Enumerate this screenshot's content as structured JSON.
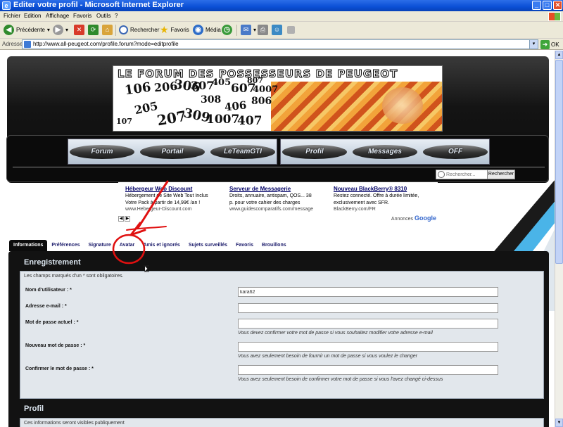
{
  "window": {
    "title": "Editer votre profil - Microsoft Internet Explorer",
    "minimize": "_",
    "maximize": "□",
    "close": "✕"
  },
  "menu": [
    "Fichier",
    "Edition",
    "Affichage",
    "Favoris",
    "Outils",
    "?"
  ],
  "toolbar": {
    "back": "Précédente",
    "search": "Rechercher",
    "favorites": "Favoris",
    "media": "Média"
  },
  "address": {
    "label": "Adresse",
    "url": "http://www.all-peugeot.com/profile.forum?mode=editprofile",
    "go": "OK"
  },
  "banner": {
    "title": "LE FORUM DES POSSESSEURS DE PEUGEOT",
    "numbers": [
      "106",
      "206",
      "306",
      "307",
      "405",
      "607",
      "4007",
      "807",
      "205",
      "308",
      "406",
      "806",
      "1007",
      "407",
      "207",
      "309",
      "107"
    ]
  },
  "nav": {
    "left": [
      "Forum",
      "Portail",
      "LeTeamGTI"
    ],
    "right": [
      "Profil",
      "Messages",
      "OFF"
    ],
    "search_placeholder": "Rechercher...",
    "search_button": "Rechercher"
  },
  "ads": [
    {
      "title": "Hébergeur Web Discount",
      "lines": [
        "Hébergement de Site Web Tout Inclus",
        "Votre Pack à partir de 14,99€ /an !"
      ],
      "url": "www.Hebergeur-Discount.com"
    },
    {
      "title": "Serveur de Messagerie",
      "lines": [
        "Droits, annuaire, antispam, QOS... 38",
        "p. pour votre cahier des charges"
      ],
      "url": "www.guidescomparatifs.com/message"
    },
    {
      "title": "Nouveau BlackBerry® 8310",
      "lines": [
        "Restez connecté. Offre à durée limitée,",
        "exclusivement avec SFR."
      ],
      "url": "BlackBerry.com/FR"
    }
  ],
  "ads_label": "Annonces",
  "ads_brand": "Google",
  "tabs": [
    "Informations",
    "Préférences",
    "Signature",
    "Avatar",
    "Amis et ignorés",
    "Sujets surveillés",
    "Favoris",
    "Brouillons"
  ],
  "form": {
    "section1": "Enregistrement",
    "required_note": "Les champs marqués d'un * sont obligatoires.",
    "fields": [
      {
        "label": "Nom d'utilisateur : *",
        "value": "kara62",
        "help": ""
      },
      {
        "label": "Adresse e-mail : *",
        "value": "",
        "help": ""
      },
      {
        "label": "Mot de passe actuel : *",
        "value": "",
        "help": "Vous devez confirmer votre mot de passe si vous souhaitez modifier votre adresse e-mail"
      },
      {
        "label": "Nouveau mot de passe : *",
        "value": "",
        "help": "Vous avez seulement besoin de fournir un mot de passe si vous voulez le changer"
      },
      {
        "label": "Confirmer le mot de passe : *",
        "value": "",
        "help": "Vous avez seulement besoin de confirmer votre mot de passe si vous l'avez changé ci-dessus"
      }
    ],
    "section2": "Profil",
    "profile_note": "Ces informations seront visibles publiquement"
  },
  "colors": {
    "annotation": "#e01010",
    "titlebar": "#0a4fd6",
    "panel": "#121212"
  }
}
